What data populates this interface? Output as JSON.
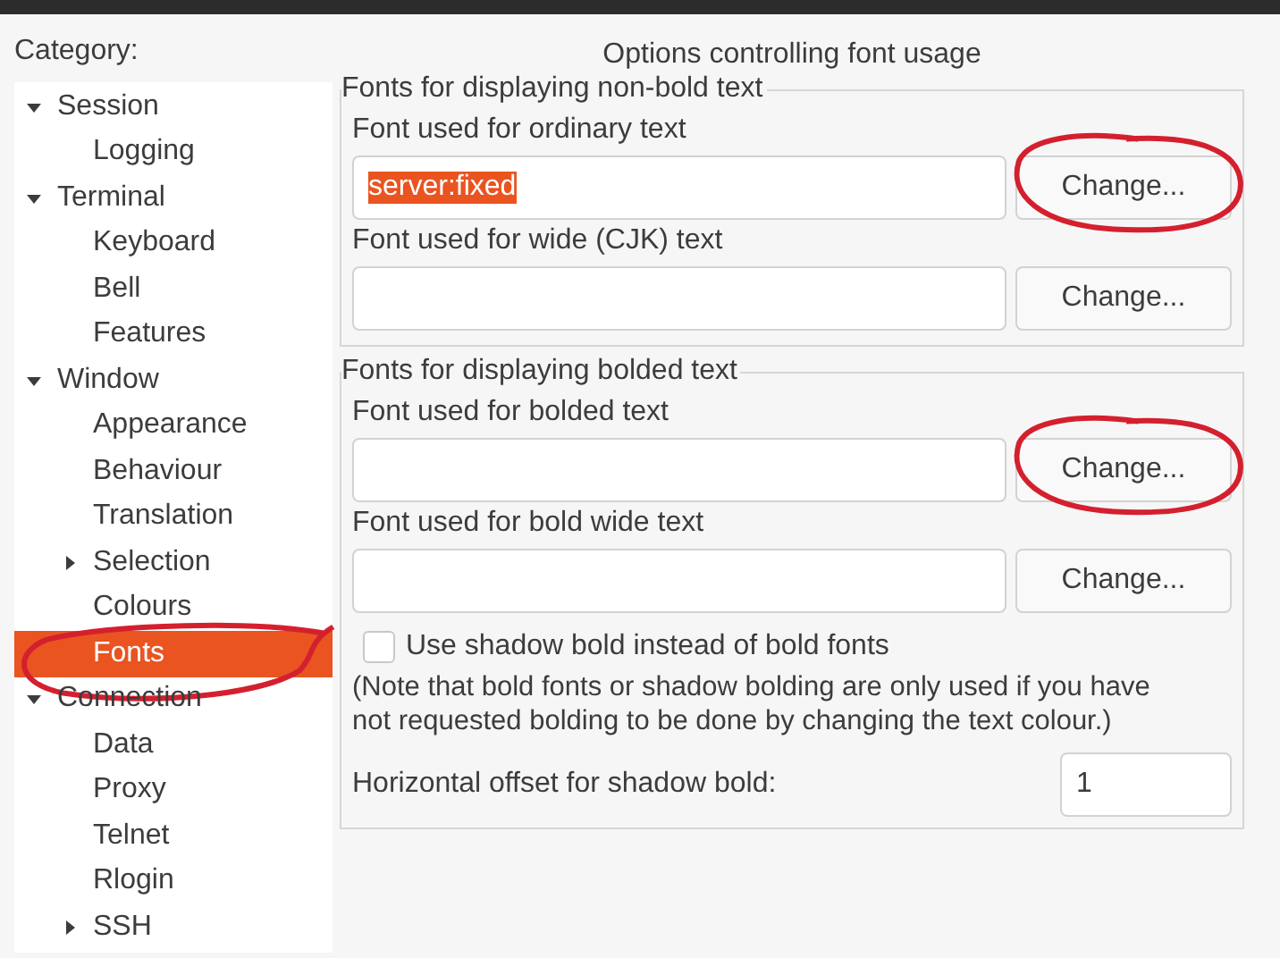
{
  "category_label": "Category:",
  "tree": [
    {
      "label": "Session",
      "expanded": true,
      "selected": false,
      "circled": false,
      "children": [
        {
          "label": "Logging",
          "selected": false,
          "circled": false
        }
      ]
    },
    {
      "label": "Terminal",
      "expanded": true,
      "selected": false,
      "circled": false,
      "children": [
        {
          "label": "Keyboard",
          "selected": false,
          "circled": false
        },
        {
          "label": "Bell",
          "selected": false,
          "circled": false
        },
        {
          "label": "Features",
          "selected": false,
          "circled": false
        }
      ]
    },
    {
      "label": "Window",
      "expanded": true,
      "selected": false,
      "circled": false,
      "children": [
        {
          "label": "Appearance",
          "selected": false,
          "circled": false
        },
        {
          "label": "Behaviour",
          "selected": false,
          "circled": false
        },
        {
          "label": "Translation",
          "selected": false,
          "circled": false
        },
        {
          "label": "Selection",
          "expanded": false,
          "selected": false,
          "circled": false
        },
        {
          "label": "Colours",
          "selected": false,
          "circled": false
        },
        {
          "label": "Fonts",
          "selected": true,
          "circled": true
        }
      ]
    },
    {
      "label": "Connection",
      "expanded": true,
      "selected": false,
      "circled": false,
      "children": [
        {
          "label": "Data",
          "selected": false,
          "circled": false
        },
        {
          "label": "Proxy",
          "selected": false,
          "circled": false
        },
        {
          "label": "Telnet",
          "selected": false,
          "circled": false
        },
        {
          "label": "Rlogin",
          "selected": false,
          "circled": false
        },
        {
          "label": "SSH",
          "expanded": false,
          "selected": false,
          "circled": false
        }
      ]
    }
  ],
  "panel": {
    "title": "Options controlling font usage",
    "groups": [
      {
        "legend": "Fonts for displaying non-bold text",
        "fonts": [
          {
            "label": "Font used for ordinary text",
            "value": "server:fixed",
            "value_selected": true,
            "button": "Change...",
            "circled": true
          },
          {
            "label": "Font used for wide (CJK) text",
            "button": "Change...",
            "circled": false
          }
        ]
      },
      {
        "legend": "Fonts for displaying bolded text",
        "fonts": [
          {
            "label": "Font used for bolded text",
            "button": "Change...",
            "circled": true
          },
          {
            "label": "Font used for bold wide text",
            "button": "Change...",
            "circled": false
          }
        ],
        "checkbox": {
          "label": "Use shadow bold instead of bold fonts",
          "checked": false
        },
        "note": "(Note that bold fonts or shadow bolding are only used if you have not requested bolding to be done by changing the text colour.)",
        "offset": {
          "label": "Horizontal offset for shadow bold:",
          "value": "1"
        }
      }
    ]
  }
}
